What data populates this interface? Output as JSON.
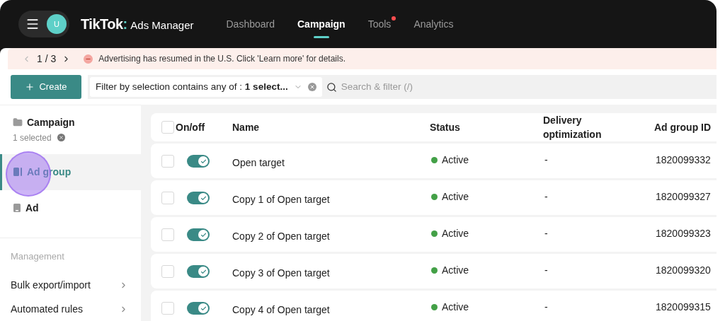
{
  "header": {
    "avatar": "U",
    "logo": "TikTok",
    "logo_separator": ":",
    "product": "Ads Manager",
    "nav": [
      {
        "label": "Dashboard",
        "selected": false,
        "badge": false
      },
      {
        "label": "Campaign",
        "selected": true,
        "badge": false
      },
      {
        "label": "Tools",
        "selected": false,
        "badge": true
      },
      {
        "label": "Analytics",
        "selected": false,
        "badge": false
      }
    ]
  },
  "banner": {
    "pager": "1 / 3",
    "message": "Advertising has resumed in the U.S. Click 'Learn more' for details."
  },
  "toolbar": {
    "create": "Create",
    "filter_prefix": "Filter by selection contains any of : ",
    "filter_value": "1 select...",
    "search_placeholder": "Search & filter (/)"
  },
  "sidebar": {
    "levels": [
      {
        "label": "Campaign",
        "kind": "folder",
        "note": "1 selected",
        "selected": false
      },
      {
        "label": "Ad group",
        "kind": "group",
        "selected": true
      },
      {
        "label": "Ad",
        "kind": "ad",
        "selected": false
      }
    ],
    "section": "Management",
    "links": [
      "Bulk export/import",
      "Automated rules"
    ]
  },
  "table": {
    "select_all": false,
    "columns": [
      "On/off",
      "Name",
      "Status",
      "Delivery optimization",
      "Ad group ID"
    ],
    "rows": [
      {
        "checked": false,
        "on": true,
        "name": "Open target",
        "status": "Active",
        "color": "#43a047",
        "delivery": "-",
        "id": "1820099332"
      },
      {
        "checked": false,
        "on": true,
        "name": "Copy 1 of Open target",
        "status": "Active",
        "color": "#43a047",
        "delivery": "-",
        "id": "1820099327"
      },
      {
        "checked": false,
        "on": true,
        "name": "Copy 2 of Open target",
        "status": "Active",
        "color": "#43a047",
        "delivery": "-",
        "id": "1820099323"
      },
      {
        "checked": false,
        "on": true,
        "name": "Copy 3 of Open target",
        "status": "Active",
        "color": "#43a047",
        "delivery": "-",
        "id": "1820099320"
      },
      {
        "checked": false,
        "on": true,
        "name": "Copy 4 of Open target",
        "status": "Active",
        "color": "#43a047",
        "delivery": "-",
        "id": "1820099315"
      }
    ]
  }
}
